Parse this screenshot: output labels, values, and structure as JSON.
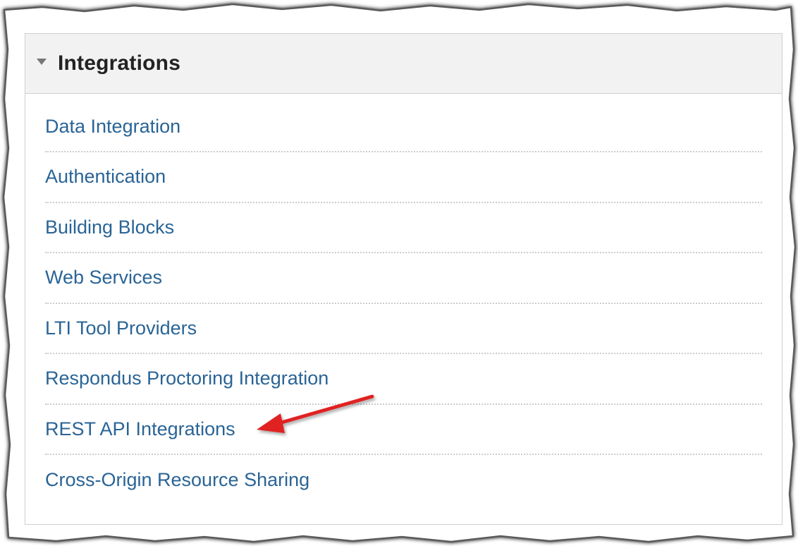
{
  "panel": {
    "title": "Integrations",
    "links": [
      "Data Integration",
      "Authentication",
      "Building Blocks",
      "Web Services",
      "LTI Tool Providers",
      "Respondus Proctoring Integration",
      "REST API Integrations",
      "Cross-Origin Resource Sharing"
    ]
  },
  "colors": {
    "link": "#2a6496",
    "header_bg": "#f2f2f2",
    "arrow": "#e02020"
  }
}
